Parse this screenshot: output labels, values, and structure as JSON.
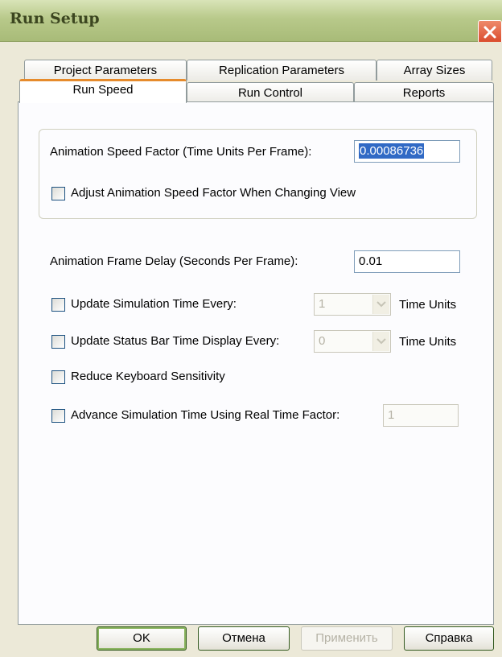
{
  "window": {
    "title": "Run Setup"
  },
  "tabs_back": [
    "Project Parameters",
    "Replication Parameters",
    "Array Sizes"
  ],
  "tabs_front": [
    "Run Speed",
    "Run Control",
    "Reports"
  ],
  "active_tab": "Run Speed",
  "group": {
    "speed_factor_label": "Animation Speed Factor (Time Units Per Frame):",
    "speed_factor_value": "0.00086736",
    "adjust_label": "Adjust Animation Speed Factor When Changing View",
    "adjust_checked": false
  },
  "frame_delay": {
    "label": "Animation Frame Delay (Seconds Per Frame):",
    "value": "0.01"
  },
  "update_sim_time": {
    "label": "Update Simulation Time Every:",
    "value": "1",
    "units": "Time Units",
    "checked": false
  },
  "update_status_bar": {
    "label": "Update Status Bar Time Display Every:",
    "value": "0",
    "units": "Time Units",
    "checked": false
  },
  "reduce_keyboard": {
    "label": "Reduce Keyboard Sensitivity",
    "checked": false
  },
  "advance_sim": {
    "label": "Advance Simulation Time Using Real Time Factor:",
    "value": "1",
    "checked": false
  },
  "buttons": {
    "ok": "OK",
    "cancel": "Отмена",
    "apply": "Применить",
    "help": "Справка"
  },
  "colors": {
    "title_bar": "#b8c98a",
    "active_tab_accent": "#e68b2c",
    "close_button": "#d9482a",
    "selection": "#316ac5"
  }
}
